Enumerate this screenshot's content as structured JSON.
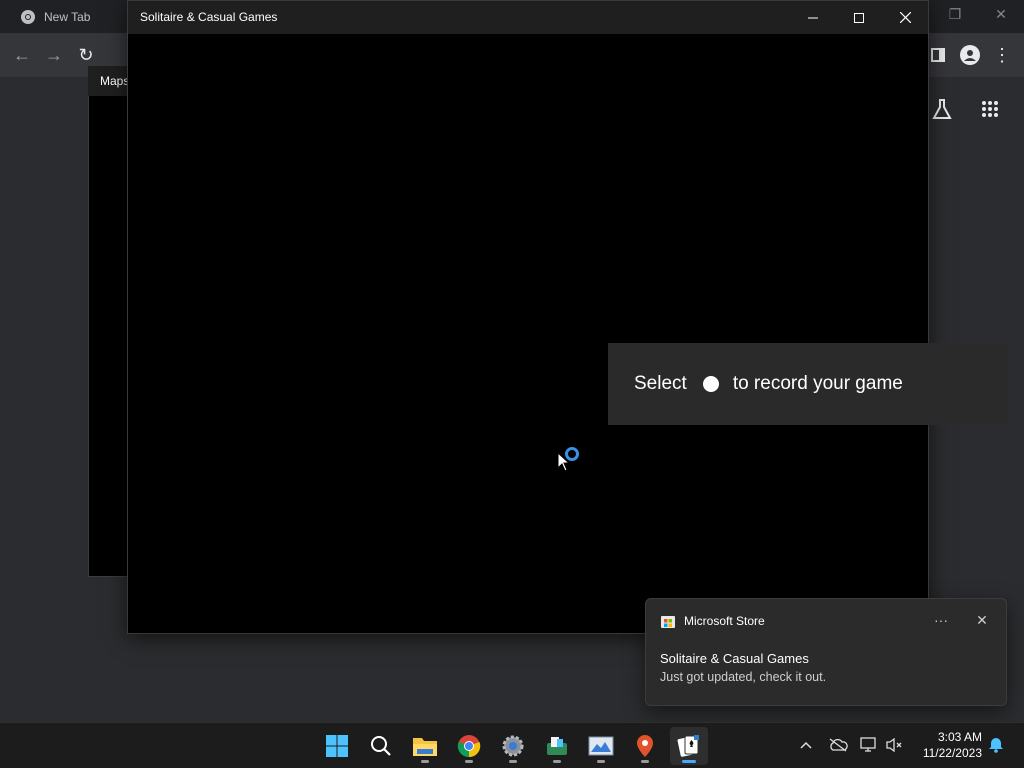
{
  "chrome": {
    "tab_title": "New Tab",
    "icons": [
      "back-icon",
      "forward-icon",
      "reload-icon",
      "side-panel-icon",
      "profile-icon",
      "more-icon",
      "labs-icon",
      "apps-grid-icon"
    ]
  },
  "maps_window": {
    "title": "Maps"
  },
  "solitaire_window": {
    "title": "Solitaire & Casual Games",
    "controls": [
      "minimize",
      "maximize",
      "close"
    ]
  },
  "gamebar_tip": {
    "prefix": "Select",
    "suffix": "to record your game",
    "icon": "record-dot-icon"
  },
  "notification": {
    "app_name": "Microsoft Store",
    "heading": "Solitaire & Casual Games",
    "body": "Just got updated, check it out.",
    "more_label": "···",
    "close_label": "✕"
  },
  "taskbar": {
    "apps": [
      {
        "name": "start",
        "icon": "windows-logo-icon"
      },
      {
        "name": "search",
        "icon": "search-icon"
      },
      {
        "name": "file-explorer",
        "icon": "folder-icon"
      },
      {
        "name": "chrome",
        "icon": "chrome-icon"
      },
      {
        "name": "settings",
        "icon": "gear-icon"
      },
      {
        "name": "app",
        "icon": "app-icon"
      },
      {
        "name": "photos",
        "icon": "photos-icon"
      },
      {
        "name": "maps",
        "icon": "map-pin-icon"
      },
      {
        "name": "solitaire",
        "icon": "cards-icon",
        "active": true
      }
    ],
    "clock": {
      "time": "3:03 AM",
      "date": "11/22/2023"
    }
  }
}
